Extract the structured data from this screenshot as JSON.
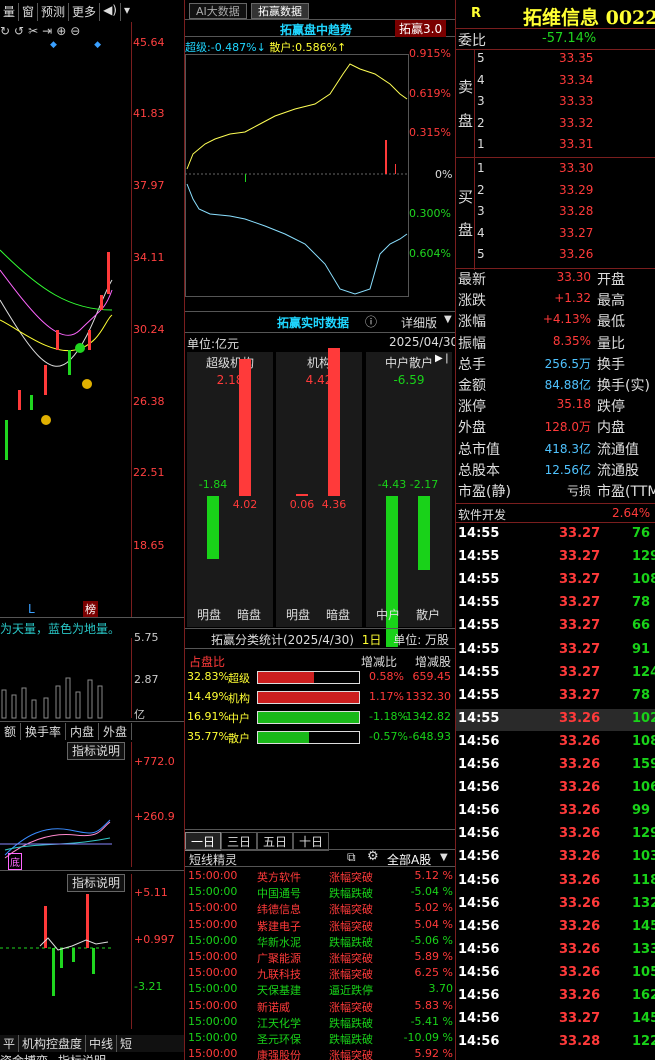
{
  "left": {
    "toolbar": [
      "量",
      "窗",
      "预测",
      "更多"
    ],
    "price_axis": [
      "45.64",
      "41.83",
      "37.97",
      "34.11",
      "30.24",
      "26.38",
      "22.51",
      "18.65"
    ],
    "markers": {
      "l": "L",
      "bang": "榜"
    },
    "legend_text": "为天量，蓝色为地量。",
    "vol_axis": [
      "5.75",
      "2.87",
      "亿"
    ],
    "tabs1": [
      "额",
      "换手率",
      "内盘",
      "外盘"
    ],
    "ind1": {
      "btn": "指标说明",
      "axis": [
        "+772.0",
        "+260.9"
      ],
      "tag": "底"
    },
    "ind2": {
      "btn": "指标说明",
      "axis": [
        "+5.11",
        "+0.997",
        "-3.21"
      ]
    },
    "bottom_tabs": [
      "平",
      "机构控盘度",
      "中线",
      "短"
    ],
    "bottom_tabs2": [
      "资金博弈",
      "指标说明"
    ]
  },
  "mid": {
    "tabs": [
      "AI大数据",
      "拓赢数据"
    ],
    "trend": {
      "title": "拓赢盘中趋势",
      "badge": "拓赢3.0",
      "super_label": "超级:",
      "super_val": "-0.487%",
      "retail_label": "散户:",
      "retail_val": "0.586%",
      "right_axis": [
        "0.915%",
        "0.619%",
        "0.315%",
        "0%",
        "0.300%",
        "0.604%"
      ]
    },
    "realtime": {
      "title": "拓赢实时数据",
      "detail": "详细版",
      "unit": "单位:亿元",
      "date": "2025/04/30",
      "groups": [
        {
          "name": "超级机构",
          "top": "2.18",
          "neg": "-1.84",
          "pos": "4.02",
          "l1": "明盘",
          "l2": "暗盘"
        },
        {
          "name": "机构",
          "top": "4.42",
          "neg": "0.06",
          "pos": "4.36",
          "l1": "明盘",
          "l2": "暗盘"
        },
        {
          "name": "中户散户",
          "top": "-6.59",
          "neg": "-4.43",
          "pos": "-2.17",
          "l1": "中户",
          "l2": "散户"
        }
      ]
    },
    "classify": {
      "title": "拓赢分类统计(2025/4/30)",
      "days": "1日",
      "unit": "单位: 万股",
      "hdr": [
        "占盘比",
        "增减比",
        "增减股"
      ],
      "rows": [
        {
          "pct": "32.83%",
          "name": "超级",
          "ratio": "0.58%",
          "shares": "659.45",
          "fill": 0.55
        },
        {
          "pct": "14.49%",
          "name": "机构",
          "ratio": "1.17%",
          "shares": "1332.30",
          "fill": 1.0
        },
        {
          "pct": "16.91%",
          "name": "中户",
          "ratio": "-1.18%",
          "shares": "-1342.82",
          "fill": 1.0
        },
        {
          "pct": "35.77%",
          "name": "散户",
          "ratio": "-0.57%",
          "shares": "-648.93",
          "fill": 0.5
        }
      ]
    },
    "period_tabs": [
      "一日",
      "三日",
      "五日",
      "十日"
    ],
    "sprite": {
      "title": "短线精灵",
      "filter": "全部A股",
      "rows": [
        [
          "15:00:00",
          "英方软件",
          "涨幅突破",
          "5.12 %",
          "r"
        ],
        [
          "15:00:00",
          "中国通号",
          "跌幅跌破",
          "-5.04 %",
          "g"
        ],
        [
          "15:00:00",
          "纬德信息",
          "涨幅突破",
          "5.02 %",
          "r"
        ],
        [
          "15:00:00",
          "紫建电子",
          "涨幅突破",
          "5.04 %",
          "r"
        ],
        [
          "15:00:00",
          "华新水泥",
          "跌幅跌破",
          "-5.06 %",
          "g"
        ],
        [
          "15:00:00",
          "广聚能源",
          "涨幅突破",
          "5.89 %",
          "r"
        ],
        [
          "15:00:00",
          "九联科技",
          "涨幅突破",
          "6.25 %",
          "r"
        ],
        [
          "15:00:00",
          "天保基建",
          "逼近跌停",
          "3.70",
          "g"
        ],
        [
          "15:00:00",
          "新诺威",
          "涨幅突破",
          "5.83 %",
          "r"
        ],
        [
          "15:00:00",
          "江天化学",
          "跌幅跌破",
          "-5.41 %",
          "g"
        ],
        [
          "15:00:00",
          "圣元环保",
          "跌幅跌破",
          "-10.09 %",
          "g"
        ],
        [
          "15:00:00",
          "康强股份",
          "涨幅突破",
          "5.92 %",
          "r"
        ]
      ]
    }
  },
  "right": {
    "r": "R",
    "name": "拓维信息 0022",
    "webi_label": "委比",
    "webi": "-57.14%",
    "sell_label": [
      "卖",
      "盘"
    ],
    "buy_label": [
      "买",
      "盘"
    ],
    "sell": [
      [
        "5",
        "33.35"
      ],
      [
        "4",
        "33.34"
      ],
      [
        "3",
        "33.33"
      ],
      [
        "2",
        "33.32"
      ],
      [
        "1",
        "33.31"
      ]
    ],
    "buy": [
      [
        "1",
        "33.30"
      ],
      [
        "2",
        "33.29"
      ],
      [
        "3",
        "33.28"
      ],
      [
        "4",
        "33.27"
      ],
      [
        "5",
        "33.26"
      ]
    ],
    "stats": [
      [
        "最新",
        "33.30",
        "开盘"
      ],
      [
        "涨跌",
        "+1.32",
        "最高"
      ],
      [
        "涨幅",
        "+4.13%",
        "最低"
      ],
      [
        "振幅",
        "8.35%",
        "量比"
      ],
      [
        "总手",
        "256.5万",
        "换手"
      ],
      [
        "金额",
        "84.88亿",
        "换手(实)"
      ],
      [
        "涨停",
        "35.18",
        "跌停"
      ],
      [
        "外盘",
        "128.0万",
        "内盘"
      ],
      [
        "总市值",
        "418.3亿",
        "流通值"
      ],
      [
        "总股本",
        "12.56亿",
        "流通股"
      ],
      [
        "市盈(静)",
        "亏损",
        "市盈(TTM)"
      ]
    ],
    "sector": {
      "name": "软件开发",
      "pct": "2.64%"
    },
    "ticks": [
      [
        "14:55",
        "33.27",
        "76"
      ],
      [
        "14:55",
        "33.27",
        "129"
      ],
      [
        "14:55",
        "33.27",
        "108"
      ],
      [
        "14:55",
        "33.27",
        "78"
      ],
      [
        "14:55",
        "33.27",
        "66"
      ],
      [
        "14:55",
        "33.27",
        "91"
      ],
      [
        "14:55",
        "33.27",
        "124"
      ],
      [
        "14:55",
        "33.27",
        "78"
      ],
      [
        "14:55",
        "33.26",
        "102"
      ],
      [
        "14:56",
        "33.26",
        "108"
      ],
      [
        "14:56",
        "33.26",
        "159"
      ],
      [
        "14:56",
        "33.26",
        "106"
      ],
      [
        "14:56",
        "33.26",
        "99"
      ],
      [
        "14:56",
        "33.26",
        "129"
      ],
      [
        "14:56",
        "33.26",
        "103"
      ],
      [
        "14:56",
        "33.26",
        "118"
      ],
      [
        "14:56",
        "33.26",
        "132"
      ],
      [
        "14:56",
        "33.26",
        "145"
      ],
      [
        "14:56",
        "33.26",
        "133"
      ],
      [
        "14:56",
        "33.26",
        "105"
      ],
      [
        "14:56",
        "33.26",
        "162"
      ],
      [
        "14:56",
        "33.27",
        "145"
      ],
      [
        "14:56",
        "33.28",
        "122"
      ]
    ]
  }
}
